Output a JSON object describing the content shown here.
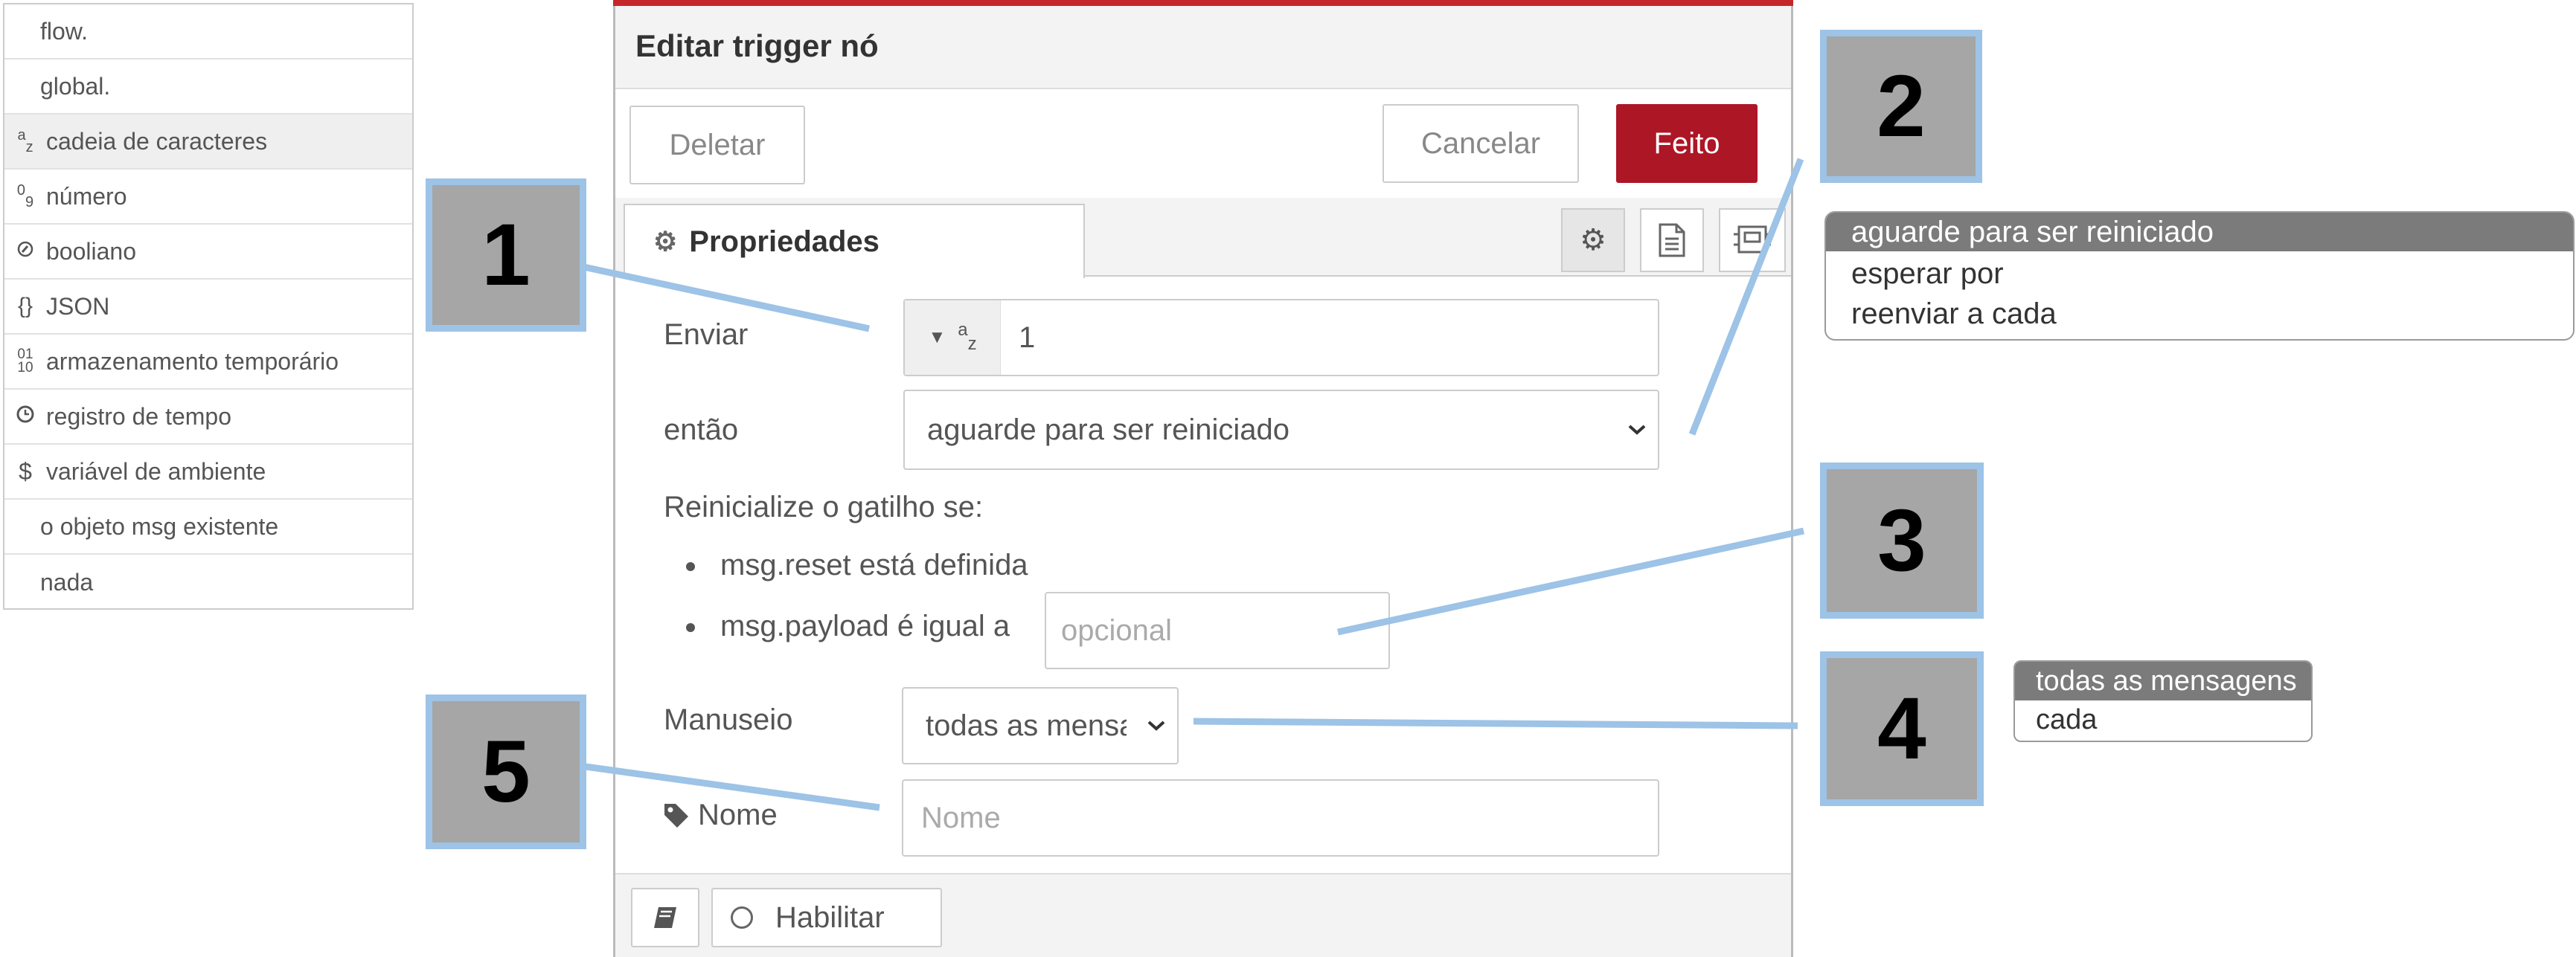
{
  "type_menu": {
    "items": [
      {
        "icon": "",
        "label": "flow."
      },
      {
        "icon": "",
        "label": "global."
      },
      {
        "icon": "az",
        "label": "cadeia de caracteres",
        "selected": true
      },
      {
        "icon": "09",
        "label": "número"
      },
      {
        "icon": "toggle-icon",
        "label": "booliano"
      },
      {
        "icon": "{}",
        "label": "JSON"
      },
      {
        "icon": "0110",
        "label": "armazenamento temporário"
      },
      {
        "icon": "clock-icon",
        "label": "registro de tempo"
      },
      {
        "icon": "$",
        "label": "variável de ambiente"
      },
      {
        "icon": "",
        "label": "o objeto msg existente"
      },
      {
        "icon": "",
        "label": "nada"
      }
    ]
  },
  "callouts": [
    "1",
    "2",
    "3",
    "4",
    "5"
  ],
  "dialog": {
    "title": "Editar trigger nó",
    "delete_label": "Deletar",
    "cancel_label": "Cancelar",
    "done_label": "Feito",
    "tab_properties": "Propriedades",
    "send_label": "Enviar",
    "send_type_icon": "az",
    "send_value": "1",
    "then_label": "então",
    "then_value": "aguarde para ser reiniciado",
    "reset_heading": "Reinicialize o gatilho se:",
    "reset_item1": "msg.reset está definida",
    "reset_item2": "msg.payload é igual a",
    "payload_placeholder": "opcional",
    "handling_label": "Manuseio",
    "handling_value": "todas as mensagens",
    "name_label": "Nome",
    "name_placeholder": "Nome",
    "enable_label": "Habilitar"
  },
  "then_options": [
    "aguarde para ser reiniciado",
    "esperar por",
    "reenviar a cada"
  ],
  "handling_options": [
    "todas as mensagens",
    "cada"
  ],
  "colors": {
    "callout_fill": "#a6a6a6",
    "callout_border": "#9dc3e6",
    "connector": "#9dc3e6",
    "done_button": "#ad1625",
    "header_bar": "#c5262a"
  }
}
